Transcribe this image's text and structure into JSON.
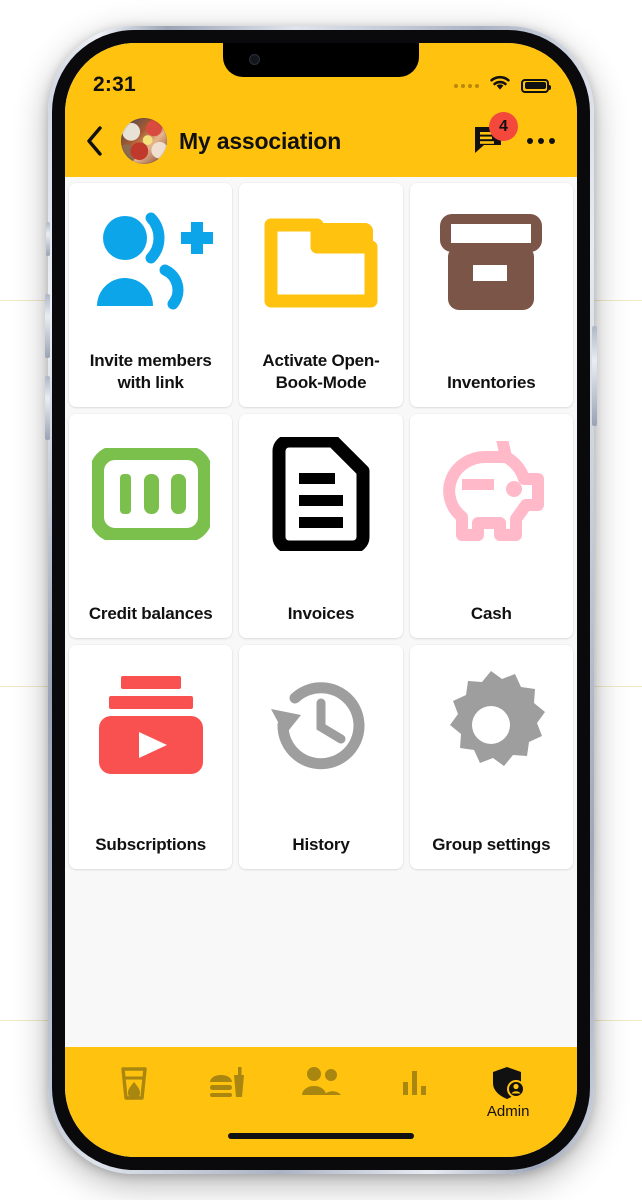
{
  "status_bar": {
    "time": "2:31",
    "signal_icon": "signal-dots-icon",
    "wifi_icon": "wifi-icon",
    "battery_icon": "battery-full-icon"
  },
  "app_bar": {
    "back_icon": "back-chevron-icon",
    "avatar_icon": "group-avatar-image",
    "title": "My association",
    "chat_icon": "chat-bubble-icon",
    "chat_badge_count": "4",
    "more_icon": "more-options-icon"
  },
  "grid": {
    "cards": [
      {
        "label": "Invite members with link",
        "icon": "person-add-share-icon",
        "color": "#0CA5E9"
      },
      {
        "label": "Activate Open-Book-Mode",
        "icon": "folder-open-icon",
        "color": "#FFC20E"
      },
      {
        "label": "Inventories",
        "icon": "archive-box-icon",
        "color": "#7A5548"
      },
      {
        "label": "Credit balances",
        "icon": "banknote-100-icon",
        "color": "#7BBF4C"
      },
      {
        "label": "Invoices",
        "icon": "document-lines-icon",
        "color": "#000000"
      },
      {
        "label": "Cash",
        "icon": "piggy-bank-icon",
        "color": "#FFB9C9"
      },
      {
        "label": "Subscriptions",
        "icon": "subscriptions-play-icon",
        "color": "#F9514F"
      },
      {
        "label": "History",
        "icon": "history-clock-icon",
        "color": "#9E9E9E"
      },
      {
        "label": "Group settings",
        "icon": "gear-icon",
        "color": "#9E9E9E"
      }
    ]
  },
  "bottom_nav": {
    "items": [
      {
        "label": "",
        "icon": "drink-cup-icon",
        "active": false
      },
      {
        "label": "",
        "icon": "fast-food-icon",
        "active": false
      },
      {
        "label": "",
        "icon": "people-group-icon",
        "active": false
      },
      {
        "label": "",
        "icon": "bar-chart-icon",
        "active": false
      },
      {
        "label": "Admin",
        "icon": "admin-shield-icon",
        "active": true
      }
    ]
  },
  "theme": {
    "brand_yellow": "#FFC20E",
    "nav_inactive": "#A8860F",
    "page_bg": "#F8F8F8",
    "badge_red": "#F4483C"
  }
}
